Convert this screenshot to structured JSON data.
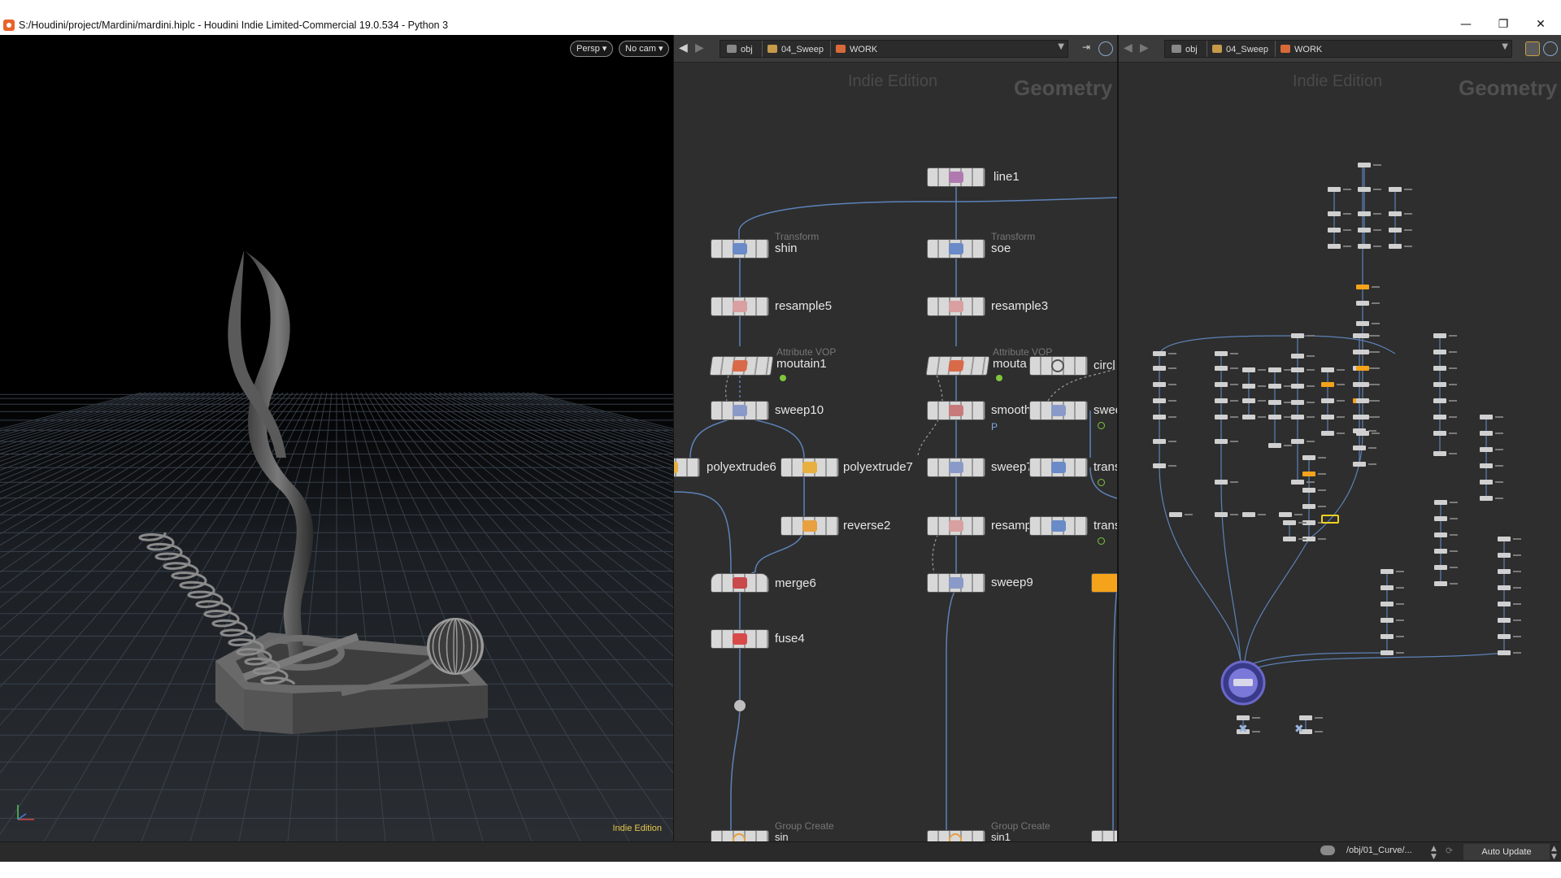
{
  "window": {
    "title": "S:/Houdini/project/Mardini/mardini.hiplc - Houdini Indie Limited-Commercial 19.0.534 - Python 3",
    "minimize": "—",
    "maximize": "❐",
    "close": "✕"
  },
  "viewport": {
    "persp_label": "Persp ▾",
    "cam_label": "No cam ▾",
    "edition_label": "Indie Edition"
  },
  "network_left": {
    "breadcrumbs": [
      "obj",
      "04_Sweep",
      "WORK"
    ],
    "watermark_edition": "Indie Edition",
    "watermark_context": "Geometry",
    "nodes": {
      "line1": "line1",
      "shin_type": "Transform",
      "shin": "shin",
      "soe_type": "Transform",
      "soe": "soe",
      "resample5": "resample5",
      "resample3": "resample3",
      "moutain1_type": "Attribute VOP",
      "moutain1": "moutain1",
      "moutai_type": "Attribute VOP",
      "moutai": "mouta",
      "circl": "circl",
      "sweep10": "sweep10",
      "smooth": "smooth",
      "swee": "swee",
      "smooth_flag": "P",
      "polyextrude6": "polyextrude6",
      "polyextrude7": "polyextrude7",
      "sweep7": "sweep7",
      "trans1": "trans",
      "reverse2": "reverse2",
      "resamp": "resamp",
      "trans2": "trans",
      "merge6": "merge6",
      "sweep9": "sweep9",
      "fuse4": "fuse4",
      "sin_type": "Group Create",
      "sin": "sin",
      "sin1_type": "Group Create",
      "sin1": "sin1"
    }
  },
  "network_right": {
    "breadcrumbs": [
      "obj",
      "04_Sweep",
      "WORK"
    ],
    "watermark_edition": "Indie Edition",
    "watermark_context": "Geometry"
  },
  "statusbar": {
    "path": "/obj/01_Curve/...",
    "update_mode": "Auto Update"
  },
  "colors": {
    "viewport_bg": "#000000",
    "network_bg": "#2e2e2e",
    "wire": "#5c82b8",
    "node_orange": "#f4a31a",
    "display_flag": "#7ec63a",
    "selected_node": "#7a78d8"
  }
}
